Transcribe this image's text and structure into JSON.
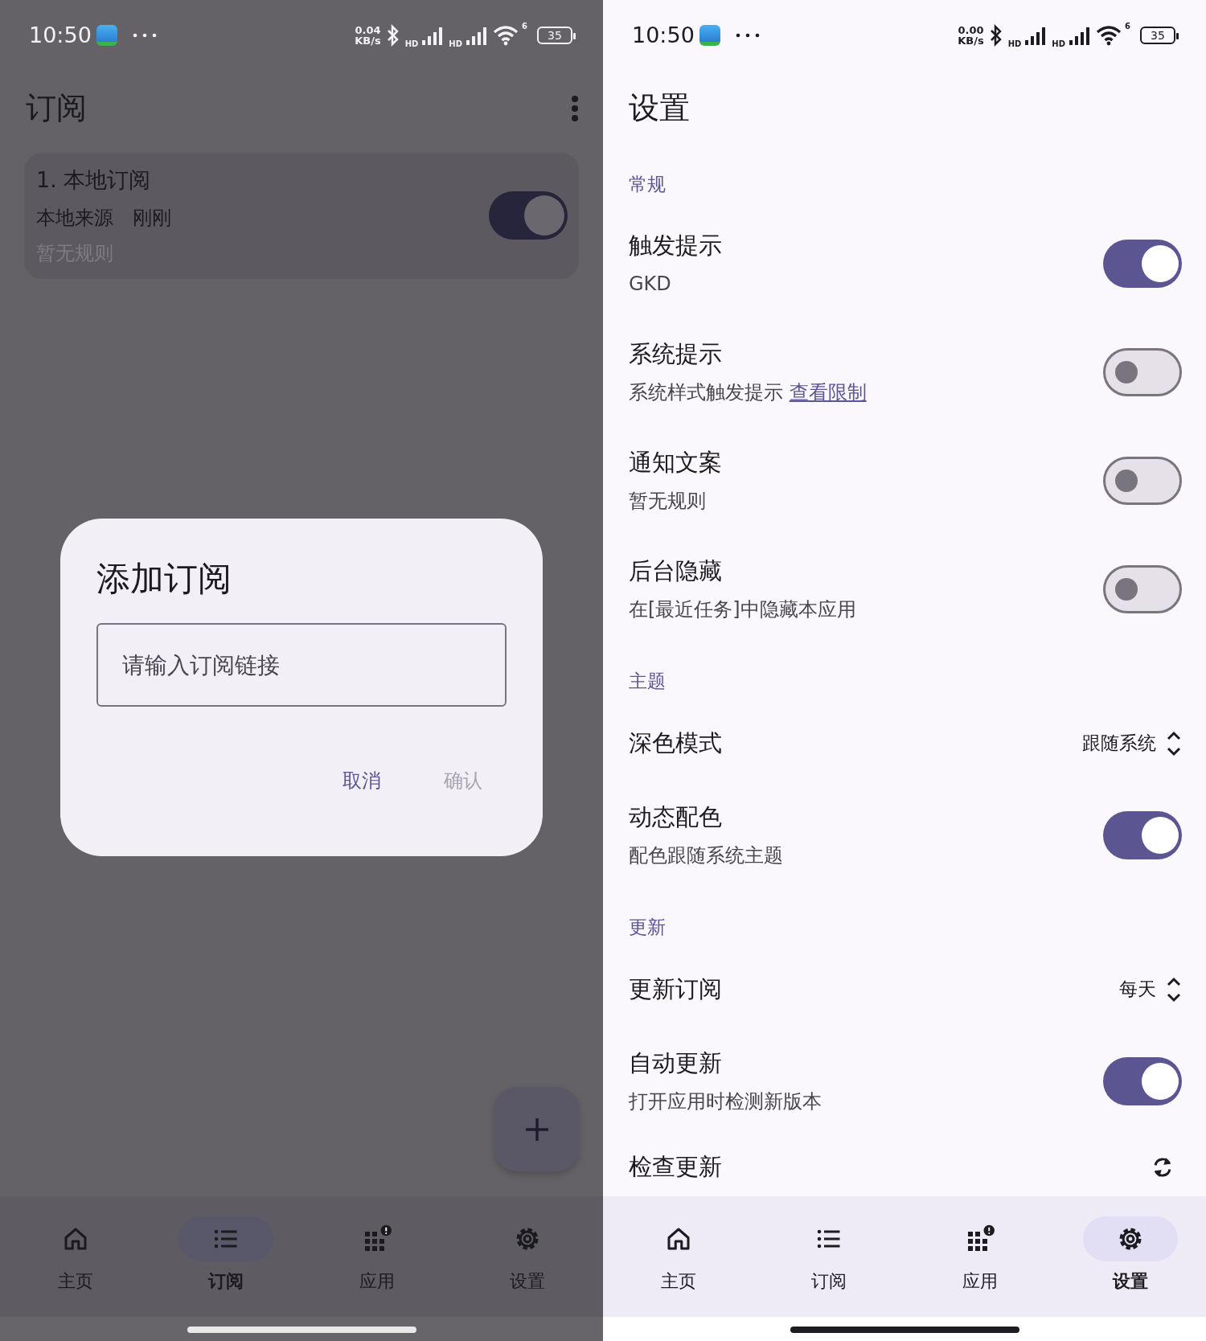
{
  "left_screen": {
    "status_bar": {
      "time": "10:50",
      "speed_value": "0.04",
      "speed_unit": "KB/s",
      "signals": [
        "HD",
        "HD"
      ],
      "wifi_label": "6",
      "battery": "35"
    },
    "title": "订阅",
    "subscriptions": [
      {
        "title": "1. 本地订阅",
        "source": "本地来源",
        "updated": "刚刚",
        "rules": "暂无规则",
        "on": true
      }
    ],
    "dialog": {
      "title": "添加订阅",
      "input": {
        "placeholder": "请输入订阅链接"
      },
      "buttons": [
        {
          "label": "取消",
          "disabled": false
        },
        {
          "label": "确认",
          "disabled": true
        }
      ]
    },
    "nav": [
      {
        "kind": "home",
        "label": "主页",
        "selected": false,
        "alert": false
      },
      {
        "kind": "list",
        "label": "订阅",
        "selected": true,
        "alert": false
      },
      {
        "kind": "grid",
        "label": "应用",
        "selected": false,
        "alert": true
      },
      {
        "kind": "gear",
        "label": "设置",
        "selected": false,
        "alert": false
      }
    ]
  },
  "right_screen": {
    "status_bar": {
      "time": "10:50",
      "speed_value": "0.00",
      "speed_unit": "KB/s",
      "signals": [
        "HD",
        "HD"
      ],
      "wifi_label": "6",
      "battery": "35"
    },
    "title": "设置",
    "sections": [
      {
        "heading": "常规",
        "items": [
          {
            "kind": "switch",
            "title": "触发提示",
            "subtitle": "GKD",
            "on": true
          },
          {
            "kind": "switch",
            "title": "系统提示",
            "subtitle": "系统样式触发提示",
            "link": "查看限制",
            "on": false
          },
          {
            "kind": "switch",
            "title": "通知文案",
            "subtitle": "暂无规则",
            "on": false
          },
          {
            "kind": "switch",
            "title": "后台隐藏",
            "subtitle": "在[最近任务]中隐藏本应用",
            "on": false
          }
        ]
      },
      {
        "heading": "主题",
        "items": [
          {
            "kind": "select",
            "title": "深色模式",
            "value": "跟随系统"
          },
          {
            "kind": "switch",
            "title": "动态配色",
            "subtitle": "配色跟随系统主题",
            "on": true
          }
        ]
      },
      {
        "heading": "更新",
        "items": [
          {
            "kind": "select",
            "title": "更新订阅",
            "value": "每天"
          },
          {
            "kind": "switch",
            "title": "自动更新",
            "subtitle": "打开应用时检测新版本",
            "on": true
          },
          {
            "kind": "action",
            "title": "检查更新"
          }
        ]
      }
    ],
    "nav": [
      {
        "kind": "home",
        "label": "主页",
        "selected": false,
        "alert": false
      },
      {
        "kind": "list",
        "label": "订阅",
        "selected": false,
        "alert": false
      },
      {
        "kind": "grid",
        "label": "应用",
        "selected": false,
        "alert": true
      },
      {
        "kind": "gear",
        "label": "设置",
        "selected": true,
        "alert": false
      }
    ]
  }
}
